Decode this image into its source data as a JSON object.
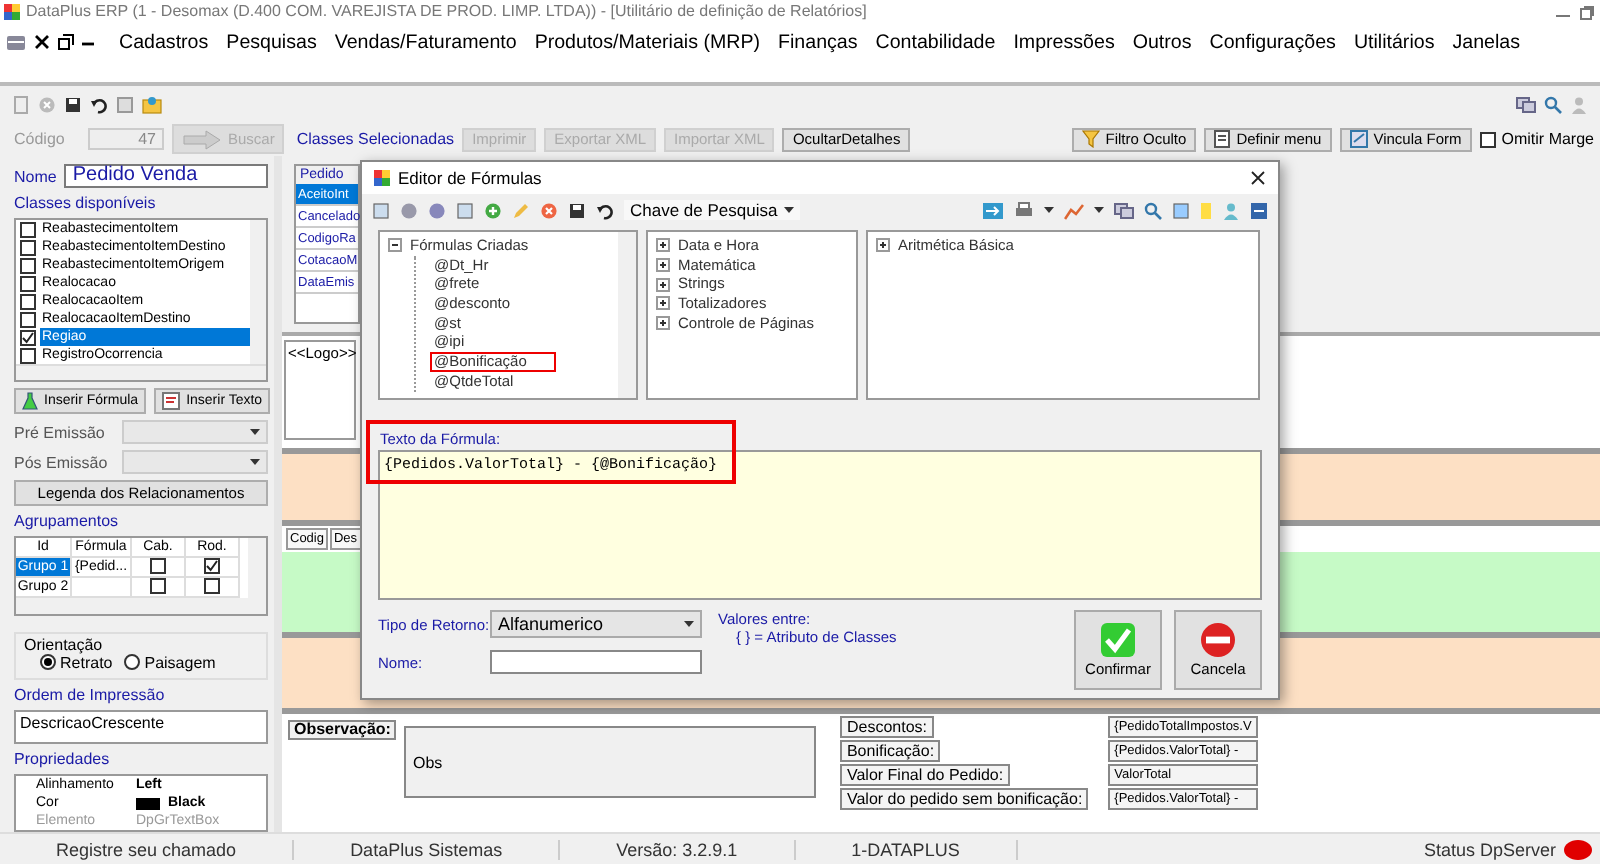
{
  "window": {
    "title": "DataPlus ERP (1 - Desomax   (D.400 COM. VAREJISTA DE PROD. LIMP. LTDA)) - [Utilitário de definição de Relatórios]"
  },
  "menu": {
    "items": [
      "Cadastros",
      "Pesquisas",
      "Vendas/Faturamento",
      "Produtos/Materiais (MRP)",
      "Finanças",
      "Contabilidade",
      "Impressões",
      "Outros",
      "Configurações",
      "Utilitários",
      "Janelas"
    ]
  },
  "form_bar": {
    "code_label": "Código",
    "code_value": "47",
    "search_button": {
      "label": "Buscar",
      "disabled": true
    },
    "selected_classes_label": "Classes Selecionadas",
    "buttons": [
      {
        "label": "Imprimir",
        "disabled": true
      },
      {
        "label": "Exportar XML",
        "disabled": true
      },
      {
        "label": "Importar XML",
        "disabled": true
      },
      {
        "label": "OcultarDetalhes",
        "disabled": false
      }
    ],
    "right_buttons": [
      {
        "kind": "filter",
        "label": "Filtro Oculto"
      },
      {
        "kind": "menu",
        "label": "Definir menu"
      },
      {
        "kind": "link",
        "label": "Vincula Form"
      }
    ],
    "omit_margin": {
      "label": "Omitir Marge",
      "checked": false
    }
  },
  "left_panel": {
    "name_label": "Nome",
    "name_value": "Pedido Venda",
    "classes_label": "Classes disponíveis",
    "classes": [
      {
        "label": "ReabastecimentoItem",
        "checked": false,
        "selected": false
      },
      {
        "label": "ReabastecimentoItemDestino",
        "checked": false,
        "selected": false
      },
      {
        "label": "ReabastecimentoItemOrigem",
        "checked": false,
        "selected": false
      },
      {
        "label": "Realocacao",
        "checked": false,
        "selected": false
      },
      {
        "label": "RealocacaoItem",
        "checked": false,
        "selected": false
      },
      {
        "label": "RealocacaoItemDestino",
        "checked": false,
        "selected": false
      },
      {
        "label": "Regiao",
        "checked": true,
        "selected": true
      },
      {
        "label": "RegistroOcorrencia",
        "checked": false,
        "selected": false
      }
    ],
    "insert_formula": "Inserir Fórmula",
    "insert_text": "Inserir Texto",
    "pre_emission_label": "Pré Emissão",
    "post_emission_label": "Pós Emissão",
    "legend_button": "Legenda dos Relacionamentos",
    "groups_label": "Agrupamentos",
    "groups_columns": [
      "Id",
      "Fórmula",
      "Cab.",
      "Rod."
    ],
    "groups": [
      {
        "id": "Grupo 1",
        "formula": "{Pedid...",
        "header": false,
        "footer": true,
        "selected": true
      },
      {
        "id": "Grupo 2",
        "header": false,
        "footer": false,
        "selected": false
      }
    ],
    "orientation_label": "Orientação",
    "orientations": [
      {
        "label": "Retrato",
        "selected": true
      },
      {
        "label": "Paisagem",
        "selected": false
      }
    ],
    "print_order_label": "Ordem de Impressão",
    "print_order": "DescricaoCrescente",
    "properties_label": "Propriedades",
    "properties": [
      {
        "name": "Alinhamento",
        "value": "Left",
        "disabled": false
      },
      {
        "name": "Cor",
        "value": "Black",
        "color": "#000000",
        "disabled": false
      },
      {
        "name": "Elemento",
        "value": "DpGrTextBox",
        "disabled": true
      }
    ]
  },
  "designer": {
    "class_title": "Pedido",
    "class_fields": [
      {
        "label": "AceitoInt",
        "selected": true
      },
      {
        "label": "Cancelado",
        "selected": false
      },
      {
        "label": "CodigoRa",
        "selected": false
      },
      {
        "label": "CotacaoM",
        "selected": false
      },
      {
        "label": "DataEmis",
        "selected": false
      }
    ],
    "logo": "<<Logo>>",
    "bands": [
      {
        "kind": "plain",
        "color": "#fde0c4"
      },
      {
        "kind": "detail",
        "color": "#c6fac6",
        "columns": [
          "Codig",
          "Des"
        ]
      },
      {
        "kind": "plain",
        "color": "#fde0c4"
      }
    ],
    "footer": {
      "obs_label": "Observação:",
      "obs_text": "Obs",
      "totals": [
        {
          "label": "Descontos:",
          "value": "{PedidoTotalImpostos.V"
        },
        {
          "label": "Bonificação:",
          "value": "{Pedidos.ValorTotal} -"
        },
        {
          "label": "Valor Final do Pedido:",
          "value": "ValorTotal"
        },
        {
          "label": "Valor do pedido sem bonificação:",
          "value": "{Pedidos.ValorTotal} -"
        }
      ]
    }
  },
  "dialog": {
    "title": "Editor de Fórmulas",
    "search_key": "Chave de Pesquisa",
    "trees": [
      [
        {
          "label": "Fórmulas Criadas",
          "expanded": true,
          "children": [
            {
              "label": "@Dt_Hr",
              "highlighted": false
            },
            {
              "label": "@frete",
              "highlighted": false
            },
            {
              "label": "@desconto",
              "highlighted": false
            },
            {
              "label": "@st",
              "highlighted": false
            },
            {
              "label": "@ipi",
              "highlighted": false
            },
            {
              "label": "@Bonificação",
              "highlighted": true
            },
            {
              "label": "@QtdeTotal",
              "highlighted": false
            }
          ]
        }
      ],
      [
        {
          "label": "Data e Hora",
          "expanded": false
        },
        {
          "label": "Matemática",
          "expanded": false
        },
        {
          "label": "Strings",
          "expanded": false
        },
        {
          "label": "Totalizadores",
          "expanded": false
        },
        {
          "label": "Controle de Páginas",
          "expanded": false
        }
      ],
      [
        {
          "label": "Aritmética Básica",
          "expanded": false
        }
      ]
    ],
    "formula_label": "Texto da Fórmula:",
    "formula": "{Pedidos.ValorTotal} - {@Bonificação}",
    "formula_highlighted": true,
    "return_type_label": "Tipo de Retorno:",
    "return_type": "Alfanumerico",
    "name_label": "Nome:",
    "hint_title": "Valores entre:",
    "hint": "{ } = Atributo de Classes",
    "confirm": "Confirmar",
    "cancel": "Cancela"
  },
  "status_bar": {
    "items": [
      "Registre seu chamado",
      "DataPlus Sistemas",
      "Versão: 3.2.9.1",
      "1-DATAPLUS"
    ],
    "server": {
      "label": "Status DpServer",
      "color": "#e00000"
    }
  }
}
